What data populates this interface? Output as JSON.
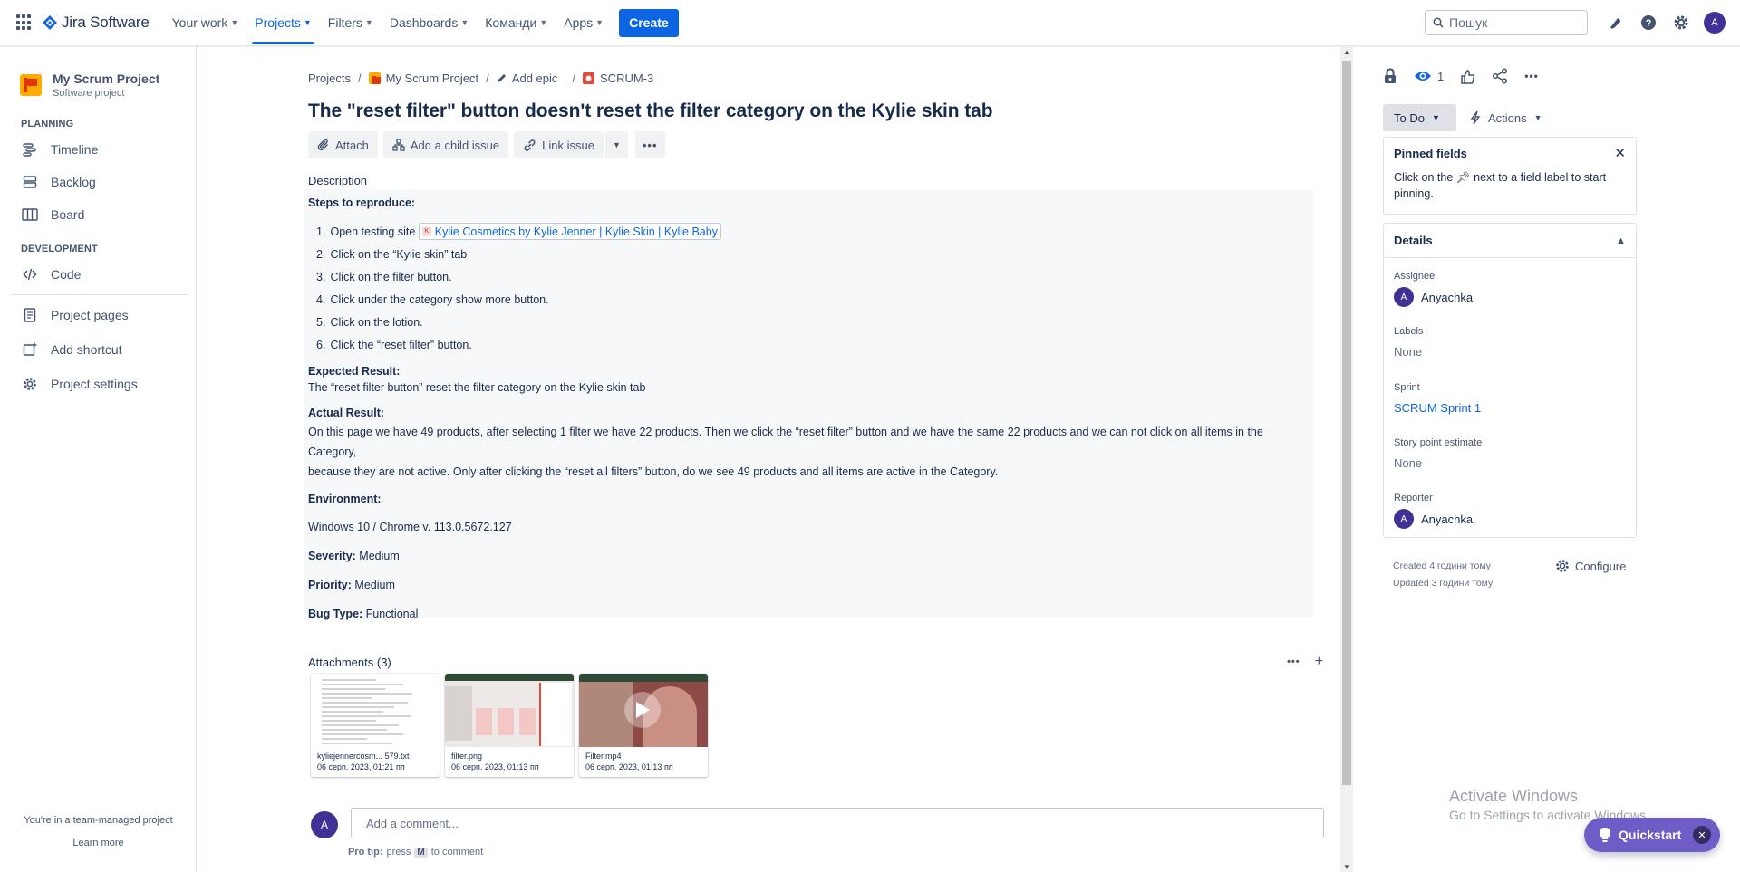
{
  "nav": {
    "product": "Jira Software",
    "items": [
      {
        "label": "Your work",
        "active": false
      },
      {
        "label": "Projects",
        "active": true
      },
      {
        "label": "Filters",
        "active": false
      },
      {
        "label": "Dashboards",
        "active": false
      },
      {
        "label": "Команди",
        "active": false
      },
      {
        "label": "Apps",
        "active": false
      }
    ],
    "create_label": "Create",
    "search_placeholder": "Пошук",
    "user_initial": "A",
    "accent": "#0c66e4"
  },
  "sidebar": {
    "project_name": "My Scrum Project",
    "project_type": "Software project",
    "planning_title": "PLANNING",
    "planning_items": [
      "Timeline",
      "Backlog",
      "Board"
    ],
    "development_title": "DEVELOPMENT",
    "development_items": [
      "Code"
    ],
    "other_items": [
      "Project pages",
      "Add shortcut",
      "Project settings"
    ],
    "footer_text": "You're in a team-managed project",
    "footer_link": "Learn more"
  },
  "breadcrumb": {
    "projects": "Projects",
    "project": "My Scrum Project",
    "epic": "Add epic",
    "issue_key": "SCRUM-3"
  },
  "issue": {
    "title": "The \"reset filter\" button doesn't reset the filter category on the Kylie skin tab",
    "toolbar": {
      "attach": "Attach",
      "child": "Add a child issue",
      "link": "Link issue"
    },
    "description_label": "Description",
    "steps_heading": "Steps to reproduce:",
    "steps": [
      {
        "num": "1.",
        "text": "Open testing site"
      },
      {
        "num": "2.",
        "text": "Click on the “Kylie skin” tab"
      },
      {
        "num": "3.",
        "text": "Click on the filter button."
      },
      {
        "num": "4.",
        "text": "Click under the category show more button."
      },
      {
        "num": "5.",
        "text": "Click on the lotion."
      },
      {
        "num": "6.",
        "text": "Click the “reset filter” button."
      }
    ],
    "site_link": "Kylie Cosmetics by Kylie Jenner | Kylie Skin | Kylie Baby",
    "expected_heading": "Expected Result:",
    "expected_text": "The “reset filter button” reset the filter category on the Kylie skin tab",
    "actual_heading": "Actual Result:",
    "actual_text_1": "On this page we have 49 products, after selecting 1 filter we have 22 products. Then we click the “reset filter” button and we have the same 22 products and we can not click on all items in the Category,",
    "actual_text_2": "because they are not active. Only after clicking the “reset all filters” button, do we see 49 products and all items are active in the Category.",
    "environment_heading": "Environment:",
    "environment_text": "Windows 10 / Chrome v.  113.0.5672.127",
    "severity_label": "Severity:",
    "severity_value": "Medium",
    "priority_label": "Priority:",
    "priority_value": "Medium",
    "bugtype_label": "Bug Type:",
    "bugtype_value": "Functional"
  },
  "attachments": {
    "title": "Attachments (3)",
    "files": [
      {
        "name": "kyliejennercosm... 579.txt",
        "date": "06 серп. 2023, 01:21 пп"
      },
      {
        "name": "filter.png",
        "date": "06 серп. 2023, 01:13 пп"
      },
      {
        "name": "Filter.mp4",
        "date": "06 серп. 2023, 01:13 пп"
      }
    ]
  },
  "comment": {
    "avatar": "A",
    "placeholder": "Add a comment...",
    "protip_prefix": "Pro tip:",
    "protip_press": "press",
    "protip_key": "M",
    "protip_suffix": "to comment"
  },
  "right": {
    "watch_count": "1",
    "status": "To Do",
    "actions": "Actions",
    "pinned_title": "Pinned fields",
    "pinned_text_a": "Click on the",
    "pinned_text_b": "next to a field label to start pinning.",
    "details_title": "Details",
    "assignee_label": "Assignee",
    "assignee": "Anyachka",
    "labels_label": "Labels",
    "labels_value": "None",
    "sprint_label": "Sprint",
    "sprint_value": "SCRUM Sprint 1",
    "story_label": "Story point estimate",
    "story_value": "None",
    "reporter_label": "Reporter",
    "reporter": "Anyachka",
    "created": "Created 4 години тому",
    "updated": "Updated 3 години тому",
    "configure": "Configure"
  },
  "overlay": {
    "activate_title": "Activate Windows",
    "activate_sub": "Go to Settings to activate Windows.",
    "quickstart": "Quickstart"
  }
}
